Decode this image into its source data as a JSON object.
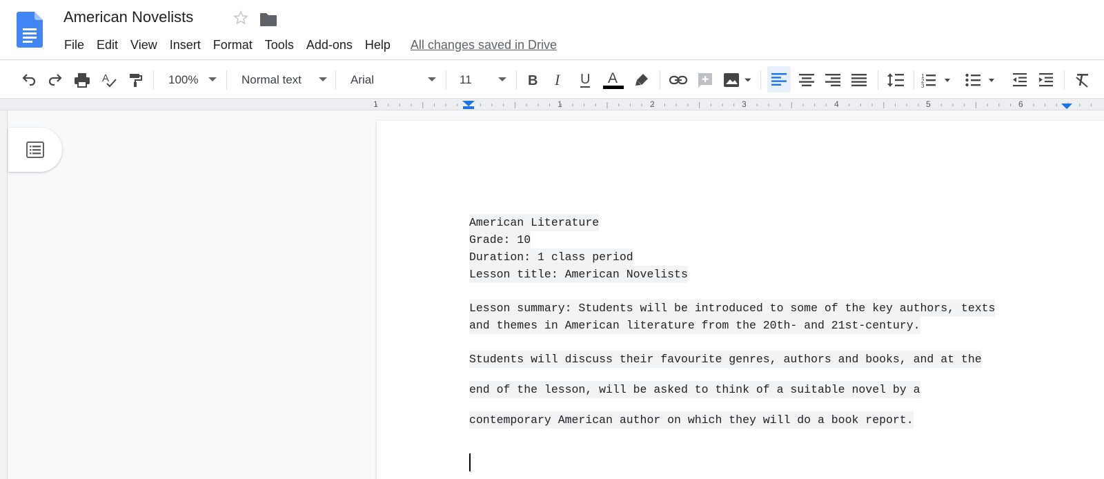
{
  "app": {
    "title": "American Novelists",
    "save_status": "All changes saved in Drive"
  },
  "menu": [
    "File",
    "Edit",
    "View",
    "Insert",
    "Format",
    "Tools",
    "Add-ons",
    "Help"
  ],
  "toolbar": {
    "zoom": "100%",
    "style": "Normal text",
    "font": "Arial",
    "font_size": "11",
    "text_color": "#000000",
    "accent_color": "#1a73e8"
  },
  "ruler": {
    "numbers": [
      "1",
      "1",
      "2",
      "3",
      "4",
      "5",
      "6"
    ]
  },
  "document": {
    "header_lines": [
      "American Literature",
      "Grade: 10",
      "Duration: 1 class period",
      "Lesson title: American Novelists"
    ],
    "summary_lines": [
      "Lesson summary: Students will be introduced to some of the key authors, texts",
      "and themes in American literature from the 20th- and 21st-century."
    ],
    "discussion_lines": [
      "Students will discuss their favourite genres, authors and books, and at the",
      "end of the lesson, will be asked to think of a suitable novel by a",
      "contemporary American author on which they will do a book report."
    ]
  }
}
